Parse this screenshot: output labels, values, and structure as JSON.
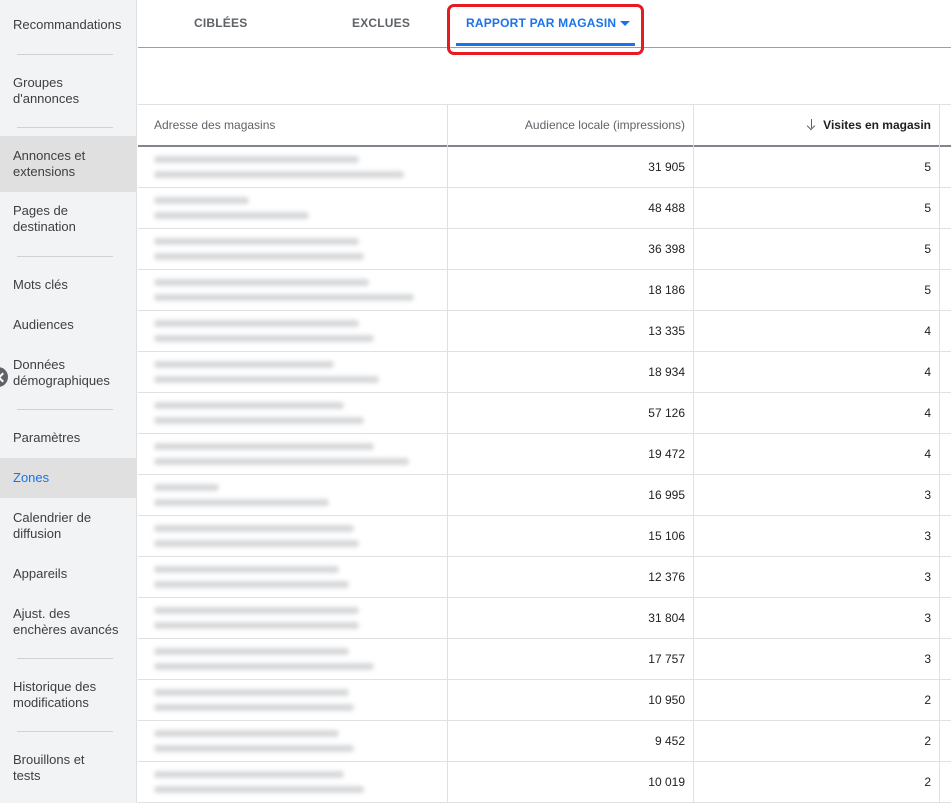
{
  "sidebar": {
    "items": [
      {
        "label": "Recommandations"
      },
      {
        "label": "Groupes d'annonces"
      },
      {
        "label": "Annonces et extensions"
      },
      {
        "label": "Pages de destination"
      },
      {
        "label": "Mots clés"
      },
      {
        "label": "Audiences"
      },
      {
        "label": "Données démographiques"
      },
      {
        "label": "Paramètres"
      },
      {
        "label": "Zones"
      },
      {
        "label": "Calendrier de diffusion"
      },
      {
        "label": "Appareils"
      },
      {
        "label": "Ajust. des enchères avancés"
      },
      {
        "label": "Historique des modifications"
      },
      {
        "label": "Brouillons et tests"
      }
    ]
  },
  "tabs": {
    "ciblees": "CIBLÉES",
    "exclues": "EXCLUES",
    "rapport": "RAPPORT PAR MAGASIN"
  },
  "table": {
    "headers": {
      "adresse": "Adresse des magasins",
      "audience": "Audience locale (impressions)",
      "visites": "Visites en magasin"
    },
    "rows": [
      {
        "audience": "31 905",
        "visites": "5"
      },
      {
        "audience": "48 488",
        "visites": "5"
      },
      {
        "audience": "36 398",
        "visites": "5"
      },
      {
        "audience": "18 186",
        "visites": "5"
      },
      {
        "audience": "13 335",
        "visites": "4"
      },
      {
        "audience": "18 934",
        "visites": "4"
      },
      {
        "audience": "57 126",
        "visites": "4"
      },
      {
        "audience": "19 472",
        "visites": "4"
      },
      {
        "audience": "16 995",
        "visites": "3"
      },
      {
        "audience": "15 106",
        "visites": "3"
      },
      {
        "audience": "12 376",
        "visites": "3"
      },
      {
        "audience": "31 804",
        "visites": "3"
      },
      {
        "audience": "17 757",
        "visites": "3"
      },
      {
        "audience": "10 950",
        "visites": "2"
      },
      {
        "audience": "9 452",
        "visites": "2"
      },
      {
        "audience": "10 019",
        "visites": "2"
      }
    ]
  },
  "colors": {
    "accent": "#1a73e8",
    "highlight": "#e8191f"
  }
}
